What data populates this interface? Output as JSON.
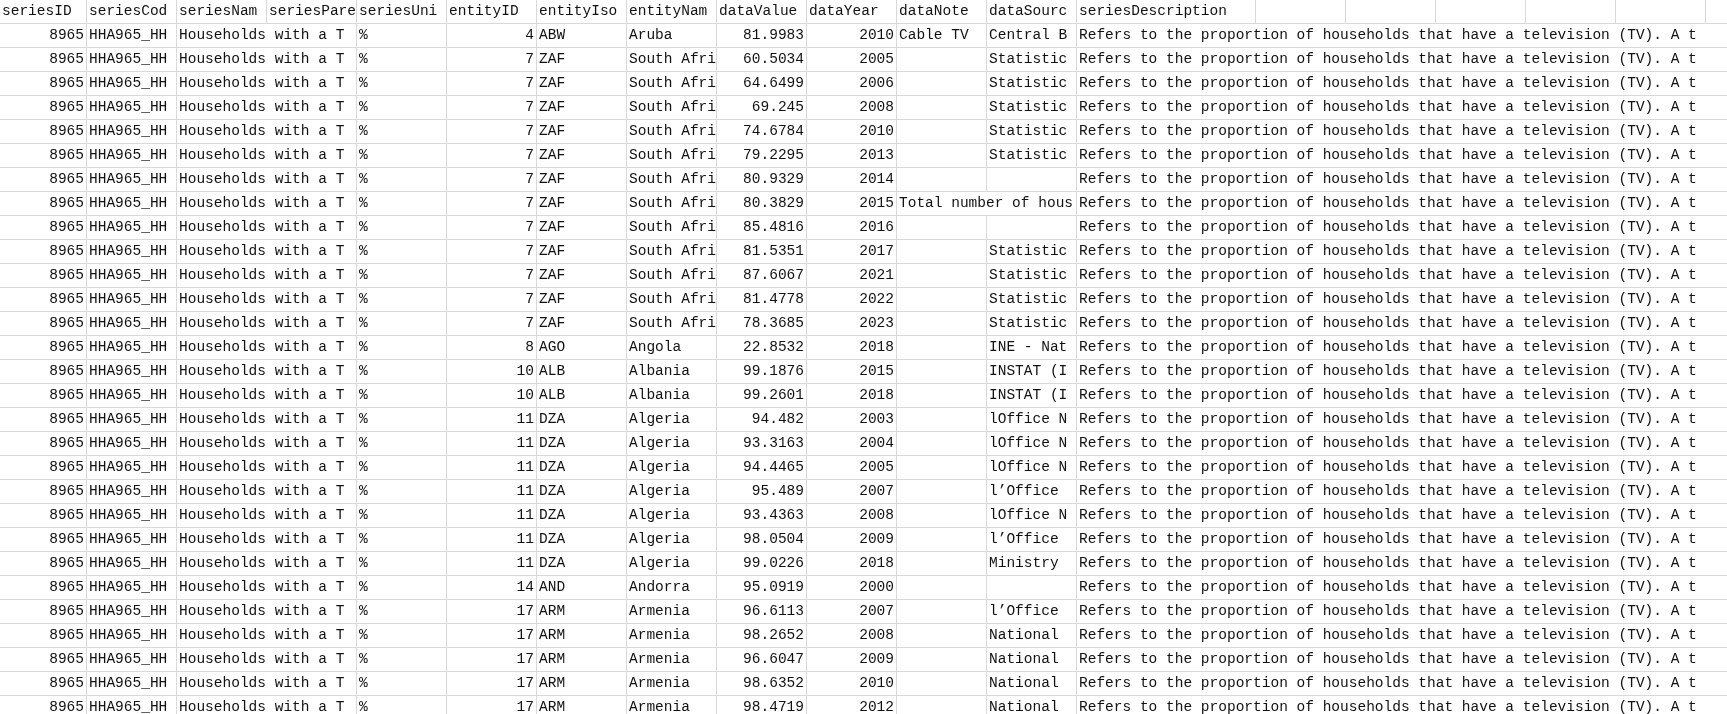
{
  "sheet": {
    "columns": [
      "seriesID",
      "seriesCod",
      "seriesNam",
      "seriesPare",
      "seriesUni",
      "entityID",
      "entityIso",
      "entityNam",
      "dataValue",
      "dataYear",
      "dataNote",
      "dataSourc",
      "seriesDescription"
    ],
    "rows": [
      [
        "8965",
        "HHA965_HH",
        "Households with a T",
        null,
        "%",
        "4",
        "ABW",
        "Aruba",
        "81.9983",
        "2010",
        "Cable TV",
        "Central B",
        "Refers to the proportion of households that have a television (TV). A t"
      ],
      [
        "8965",
        "HHA965_HH",
        "Households with a T",
        null,
        "%",
        "7",
        "ZAF",
        "South Afri",
        "60.5034",
        "2005",
        null,
        "Statistic",
        "Refers to the proportion of households that have a television (TV). A t"
      ],
      [
        "8965",
        "HHA965_HH",
        "Households with a T",
        null,
        "%",
        "7",
        "ZAF",
        "South Afri",
        "64.6499",
        "2006",
        null,
        "Statistic",
        "Refers to the proportion of households that have a television (TV). A t"
      ],
      [
        "8965",
        "HHA965_HH",
        "Households with a T",
        null,
        "%",
        "7",
        "ZAF",
        "South Afri",
        "69.245",
        "2008",
        null,
        "Statistic",
        "Refers to the proportion of households that have a television (TV). A t"
      ],
      [
        "8965",
        "HHA965_HH",
        "Households with a T",
        null,
        "%",
        "7",
        "ZAF",
        "South Afri",
        "74.6784",
        "2010",
        null,
        "Statistic",
        "Refers to the proportion of households that have a television (TV). A t"
      ],
      [
        "8965",
        "HHA965_HH",
        "Households with a T",
        null,
        "%",
        "7",
        "ZAF",
        "South Afri",
        "79.2295",
        "2013",
        null,
        "Statistic",
        "Refers to the proportion of households that have a television (TV). A t"
      ],
      [
        "8965",
        "HHA965_HH",
        "Households with a T",
        null,
        "%",
        "7",
        "ZAF",
        "South Afri",
        "80.9329",
        "2014",
        null,
        null,
        "Refers to the proportion of households that have a television (TV). A t"
      ],
      [
        "8965",
        "HHA965_HH",
        "Households with a T",
        null,
        "%",
        "7",
        "ZAF",
        "South Afri",
        "80.3829",
        "2015",
        "Total number of hous",
        null,
        "Refers to the proportion of households that have a television (TV). A t"
      ],
      [
        "8965",
        "HHA965_HH",
        "Households with a T",
        null,
        "%",
        "7",
        "ZAF",
        "South Afri",
        "85.4816",
        "2016",
        null,
        null,
        "Refers to the proportion of households that have a television (TV). A t"
      ],
      [
        "8965",
        "HHA965_HH",
        "Households with a T",
        null,
        "%",
        "7",
        "ZAF",
        "South Afri",
        "81.5351",
        "2017",
        null,
        "Statistic",
        "Refers to the proportion of households that have a television (TV). A t"
      ],
      [
        "8965",
        "HHA965_HH",
        "Households with a T",
        null,
        "%",
        "7",
        "ZAF",
        "South Afri",
        "87.6067",
        "2021",
        null,
        "Statistic",
        "Refers to the proportion of households that have a television (TV). A t"
      ],
      [
        "8965",
        "HHA965_HH",
        "Households with a T",
        null,
        "%",
        "7",
        "ZAF",
        "South Afri",
        "81.4778",
        "2022",
        null,
        "Statistic",
        "Refers to the proportion of households that have a television (TV). A t"
      ],
      [
        "8965",
        "HHA965_HH",
        "Households with a T",
        null,
        "%",
        "7",
        "ZAF",
        "South Afri",
        "78.3685",
        "2023",
        null,
        "Statistic",
        "Refers to the proportion of households that have a television (TV). A t"
      ],
      [
        "8965",
        "HHA965_HH",
        "Households with a T",
        null,
        "%",
        "8",
        "AGO",
        "Angola",
        "22.8532",
        "2018",
        null,
        "INE - Nat",
        "Refers to the proportion of households that have a television (TV). A t"
      ],
      [
        "8965",
        "HHA965_HH",
        "Households with a T",
        null,
        "%",
        "10",
        "ALB",
        "Albania",
        "99.1876",
        "2015",
        null,
        "INSTAT (I",
        "Refers to the proportion of households that have a television (TV). A t"
      ],
      [
        "8965",
        "HHA965_HH",
        "Households with a T",
        null,
        "%",
        "10",
        "ALB",
        "Albania",
        "99.2601",
        "2018",
        null,
        "INSTAT (I",
        "Refers to the proportion of households that have a television (TV). A t"
      ],
      [
        "8965",
        "HHA965_HH",
        "Households with a T",
        null,
        "%",
        "11",
        "DZA",
        "Algeria",
        "94.482",
        "2003",
        null,
        "lOffice N",
        "Refers to the proportion of households that have a television (TV). A t"
      ],
      [
        "8965",
        "HHA965_HH",
        "Households with a T",
        null,
        "%",
        "11",
        "DZA",
        "Algeria",
        "93.3163",
        "2004",
        null,
        "lOffice N",
        "Refers to the proportion of households that have a television (TV). A t"
      ],
      [
        "8965",
        "HHA965_HH",
        "Households with a T",
        null,
        "%",
        "11",
        "DZA",
        "Algeria",
        "94.4465",
        "2005",
        null,
        "lOffice N",
        "Refers to the proportion of households that have a television (TV). A t"
      ],
      [
        "8965",
        "HHA965_HH",
        "Households with a T",
        null,
        "%",
        "11",
        "DZA",
        "Algeria",
        "95.489",
        "2007",
        null,
        "l’Office",
        "Refers to the proportion of households that have a television (TV). A t"
      ],
      [
        "8965",
        "HHA965_HH",
        "Households with a T",
        null,
        "%",
        "11",
        "DZA",
        "Algeria",
        "93.4363",
        "2008",
        null,
        "lOffice N",
        "Refers to the proportion of households that have a television (TV). A t"
      ],
      [
        "8965",
        "HHA965_HH",
        "Households with a T",
        null,
        "%",
        "11",
        "DZA",
        "Algeria",
        "98.0504",
        "2009",
        null,
        "l’Office",
        "Refers to the proportion of households that have a television (TV). A t"
      ],
      [
        "8965",
        "HHA965_HH",
        "Households with a T",
        null,
        "%",
        "11",
        "DZA",
        "Algeria",
        "99.0226",
        "2018",
        null,
        "Ministry",
        "Refers to the proportion of households that have a television (TV). A t"
      ],
      [
        "8965",
        "HHA965_HH",
        "Households with a T",
        null,
        "%",
        "14",
        "AND",
        "Andorra",
        "95.0919",
        "2000",
        null,
        null,
        "Refers to the proportion of households that have a television (TV). A t"
      ],
      [
        "8965",
        "HHA965_HH",
        "Households with a T",
        null,
        "%",
        "17",
        "ARM",
        "Armenia",
        "96.6113",
        "2007",
        null,
        "l’Office",
        "Refers to the proportion of households that have a television (TV). A t"
      ],
      [
        "8965",
        "HHA965_HH",
        "Households with a T",
        null,
        "%",
        "17",
        "ARM",
        "Armenia",
        "98.2652",
        "2008",
        null,
        "National",
        "Refers to the proportion of households that have a television (TV). A t"
      ],
      [
        "8965",
        "HHA965_HH",
        "Households with a T",
        null,
        "%",
        "17",
        "ARM",
        "Armenia",
        "96.6047",
        "2009",
        null,
        "National",
        "Refers to the proportion of households that have a television (TV). A t"
      ],
      [
        "8965",
        "HHA965_HH",
        "Households with a T",
        null,
        "%",
        "17",
        "ARM",
        "Armenia",
        "98.6352",
        "2010",
        null,
        "National",
        "Refers to the proportion of households that have a television (TV). A t"
      ],
      [
        "8965",
        "HHA965_HH",
        "Households with a T",
        null,
        "%",
        "17",
        "ARM",
        "Armenia",
        "98.4719",
        "2012",
        null,
        "National",
        "Refers to the proportion of households that have a television (TV). A t"
      ]
    ]
  }
}
